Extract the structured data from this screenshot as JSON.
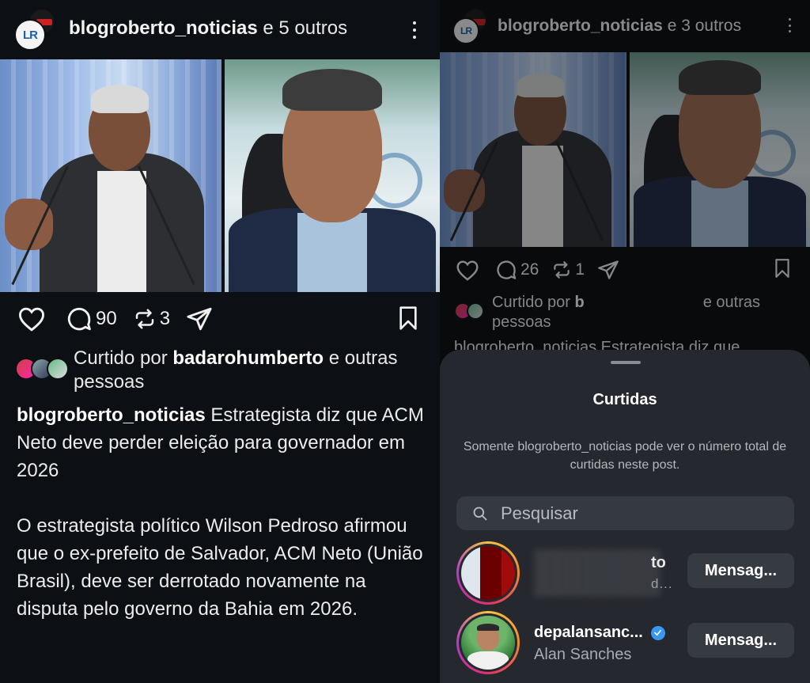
{
  "left": {
    "header": {
      "username": "blogroberto_noticias",
      "suffix": " e 5 outros",
      "avatar_logo": "LR"
    },
    "actions": {
      "comments": "90",
      "reposts": "3"
    },
    "liked": {
      "prefix": "Curtido por ",
      "user": "badarohumberto",
      "suffix": " e outras pessoas"
    },
    "caption": {
      "username": "blogroberto_noticias",
      "headline": " Estrategista diz que ACM Neto deve perder eleição para governador em 2026",
      "body": "O estrategista político Wilson Pedroso afirmou que o ex-prefeito de Salvador, ACM Neto (União Brasil), deve ser derrotado novamente na disputa pelo governo da Bahia em 2026."
    }
  },
  "right": {
    "header": {
      "username": "blogroberto_noticias",
      "suffix": " e 3 outros"
    },
    "actions": {
      "comments": "26",
      "reposts": "1"
    },
    "liked": {
      "prefix": "Curtido por ",
      "hidden": "b",
      "suffix": "e outras pessoas"
    },
    "caption_peek": "blogroberto_noticias Estrategista diz que",
    "sheet": {
      "title": "Curtidas",
      "note": "Somente blogroberto_noticias pode ver o número total de curtidas neste post.",
      "search_placeholder": "Pesquisar",
      "users": [
        {
          "username_suffix": "to",
          "subtitle": "d...",
          "button": "Mensag..."
        },
        {
          "username": "depalansanc...",
          "full_name": "Alan Sanches",
          "button": "Mensag..."
        }
      ]
    }
  },
  "colors": {
    "background": "#0c0f14",
    "sheet": "#25282e",
    "verified": "#3897f0"
  }
}
